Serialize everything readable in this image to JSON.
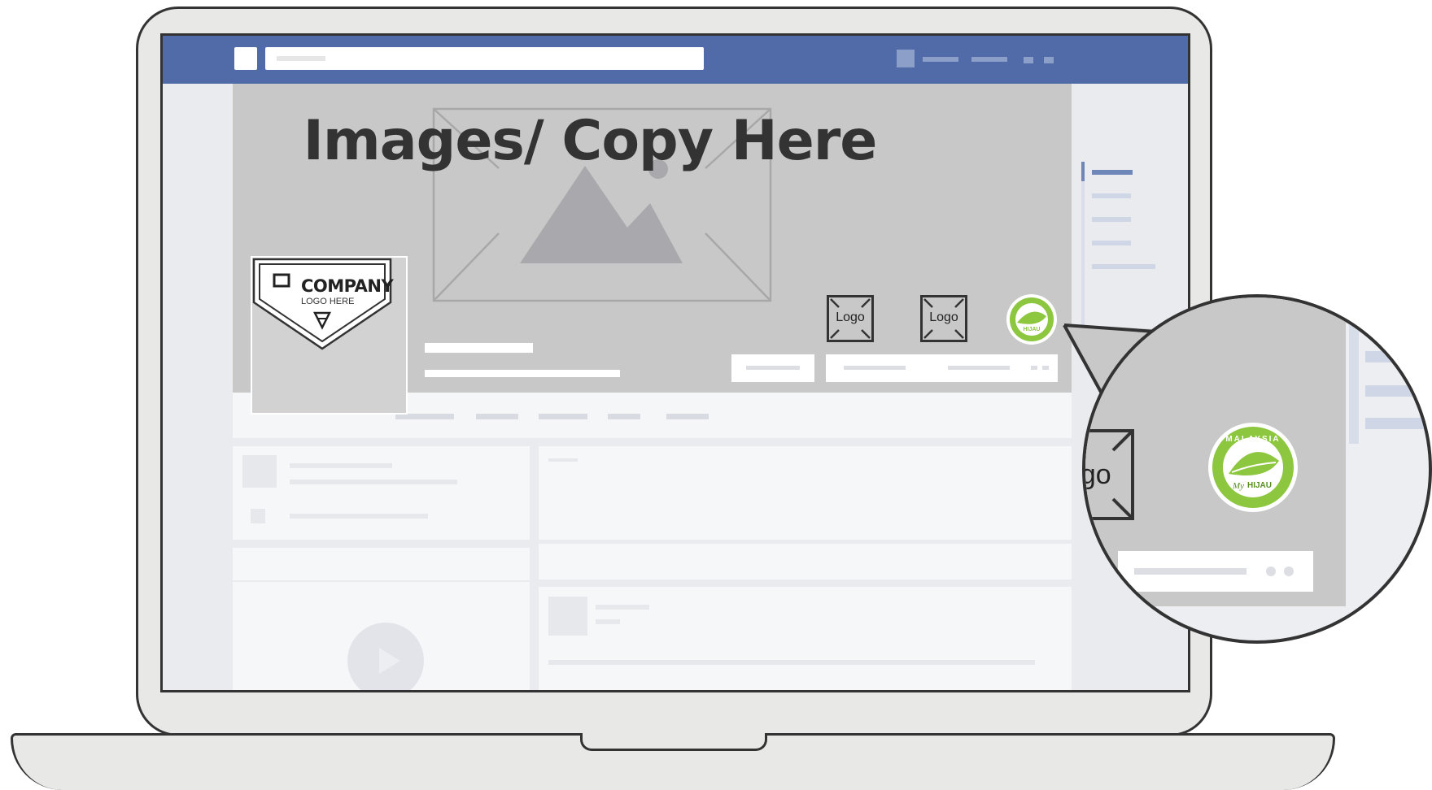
{
  "headline": "Images/ Copy Here",
  "profile": {
    "company": "COMPANY",
    "tagline": "LOGO HERE"
  },
  "logo_slots": {
    "first": "Logo",
    "second": "Logo"
  },
  "badge": {
    "top_text": "MALAYSIA",
    "script_text": "My",
    "bold_text": "HIJAU"
  },
  "magnifier": {
    "partial_logo": "Logo"
  },
  "colors": {
    "facebook_blue": "#506ba8",
    "badge_green": "#8dc63f",
    "outline": "#333333",
    "placeholder_gray": "#c8c8c8"
  },
  "icons": [
    "image-placeholder-icon",
    "expand-arrows-icon",
    "play-icon",
    "company-shield-logo",
    "myhijau-badge"
  ]
}
